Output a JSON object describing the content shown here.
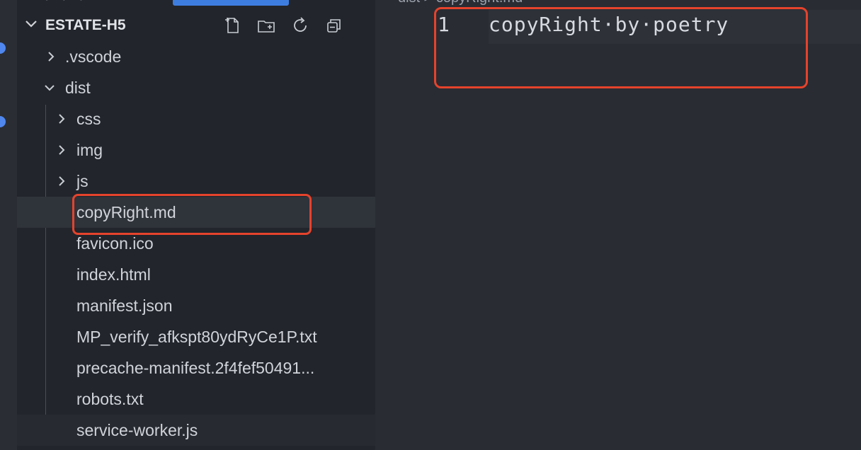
{
  "explorer": {
    "section_title": "ESTATE-H5",
    "actions": [
      "new-file-icon",
      "new-folder-icon",
      "refresh-icon",
      "collapse-all-icon"
    ],
    "items": [
      {
        "label": ".vscode",
        "type": "folder",
        "expanded": false
      },
      {
        "label": "dist",
        "type": "folder",
        "expanded": true
      },
      {
        "label": "css",
        "type": "folder",
        "expanded": false
      },
      {
        "label": "img",
        "type": "folder",
        "expanded": false
      },
      {
        "label": "js",
        "type": "folder",
        "expanded": false
      },
      {
        "label": "copyRight.md",
        "type": "file",
        "selected": true
      },
      {
        "label": "favicon.ico",
        "type": "file"
      },
      {
        "label": "index.html",
        "type": "file"
      },
      {
        "label": "manifest.json",
        "type": "file"
      },
      {
        "label": "MP_verify_afkspt80ydRyCe1P.txt",
        "type": "file"
      },
      {
        "label": "precache-manifest.2f4fef50491...",
        "type": "file"
      },
      {
        "label": "robots.txt",
        "type": "file"
      },
      {
        "label": "service-worker.js",
        "type": "file"
      }
    ]
  },
  "editor": {
    "breadcrumb": "dist > copyRight.md",
    "line_number": "1",
    "code": "copyRight·by·poetry"
  },
  "colors": {
    "highlight_box": "#e5432c",
    "sidebar_bg": "#22252b",
    "editor_bg": "#292c33",
    "text": "#d0d3d9"
  }
}
